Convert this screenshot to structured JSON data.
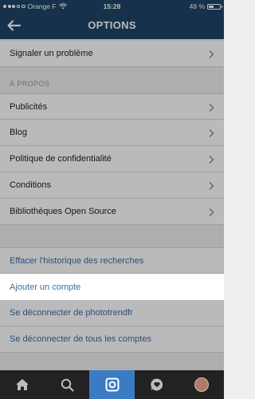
{
  "status_bar": {
    "carrier": "Orange F",
    "time": "15:28",
    "battery": "48 %",
    "battery_level": 0.48
  },
  "nav": {
    "title": "OPTIONS",
    "back_icon": "arrow-left-icon"
  },
  "rows_top": [
    {
      "label": "Signaler un problème"
    }
  ],
  "about_section": {
    "header": "À PROPOS",
    "items": [
      {
        "label": "Publicités"
      },
      {
        "label": "Blog"
      },
      {
        "label": "Politique de confidentialité"
      },
      {
        "label": "Conditions"
      },
      {
        "label": "Bibliothèques Open Source"
      }
    ]
  },
  "account_actions": [
    {
      "label": "Effacer l'historique des recherches"
    },
    {
      "label": "Ajouter un compte"
    },
    {
      "label": "Se déconnecter de phototrendfr"
    },
    {
      "label": "Se déconnecter de tous les comptes"
    }
  ],
  "tabbar": {
    "items": [
      {
        "icon": "home-icon"
      },
      {
        "icon": "search-icon"
      },
      {
        "icon": "camera-icon",
        "active": true
      },
      {
        "icon": "activity-heart-icon"
      },
      {
        "icon": "profile-avatar-icon"
      }
    ]
  },
  "colors": {
    "nav_bg": "#1f4467",
    "link_blue": "#3b6ea3",
    "tab_active": "#3a7bc4",
    "tab_bg": "#222222"
  }
}
